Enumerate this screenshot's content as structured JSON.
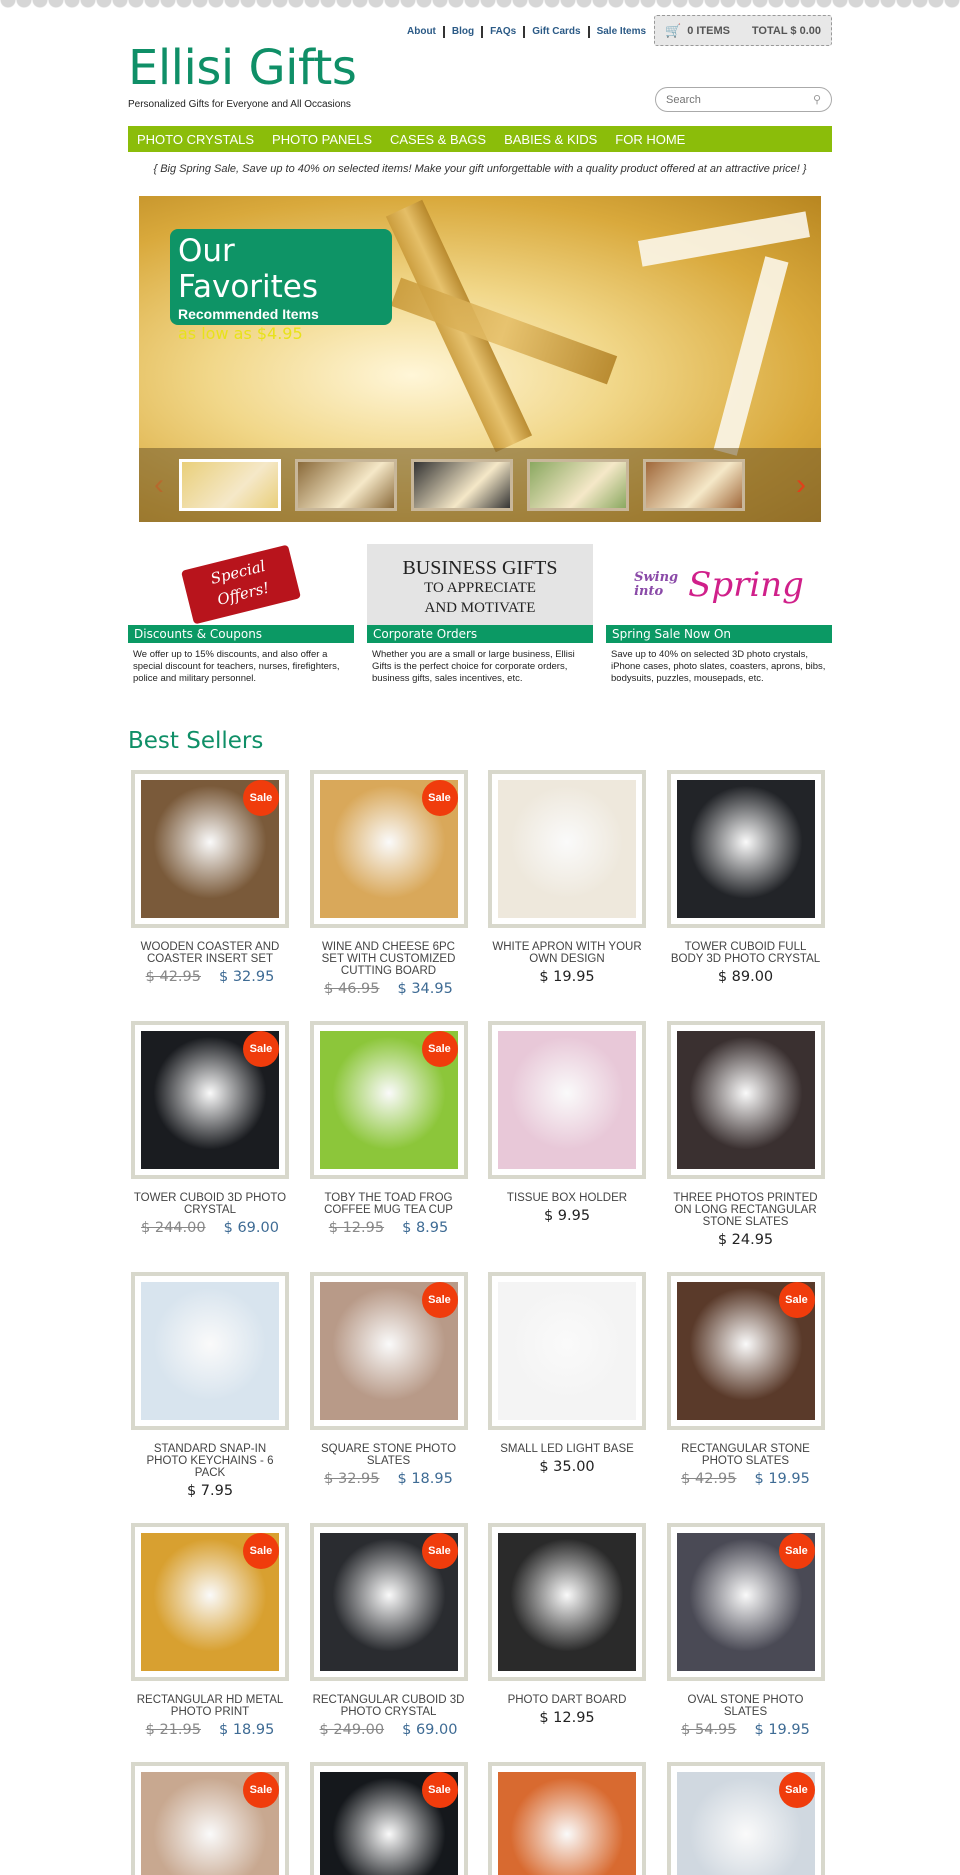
{
  "header": {
    "top_links": [
      "About",
      "Blog",
      "FAQs",
      "Gift Cards",
      "Sale Items"
    ],
    "cart": {
      "icon": "cart-icon",
      "items": "0 ITEMS",
      "total": "TOTAL $ 0.00"
    },
    "logo": "Ellisi Gifts",
    "tagline": "Personalized Gifts for Everyone and All Occasions",
    "search": {
      "placeholder": "Search",
      "icon": "search-icon"
    }
  },
  "nav": [
    "PHOTO CRYSTALS",
    "PHOTO PANELS",
    "CASES & BAGS",
    "BABIES & KIDS",
    "FOR HOME"
  ],
  "promo": "{ Big Spring Sale, Save up to 40% on selected items! Make your gift unforgettable with a quality product offered at an attractive price! }",
  "slider": {
    "title": "Our Favorites",
    "subtitle": "Recommended Items",
    "price_line": "as low as $4.95",
    "thumb_count": 5,
    "active_thumb": 1,
    "thumb_tones": [
      "#e9cf7a",
      "#8a6a3a",
      "#333333",
      "#8aa860",
      "#a0683a"
    ]
  },
  "features": [
    {
      "image_text": "Special Offers!",
      "title": "Discounts & Coupons",
      "text": "We offer up to 15% discounts, and also offer a special discount for teachers, nurses, firefighters, police and military personnel."
    },
    {
      "image_text_1": "BUSINESS GIFTS",
      "image_text_2": "TO APPRECIATE",
      "image_text_3": "AND MOTIVATE",
      "title": "Corporate Orders",
      "text": "Whether you are a small or large business, Ellisi Gifts is the perfect choice for corporate orders, business gifts, sales incentives, etc."
    },
    {
      "image_text_1": "Swing into",
      "image_text_2": "Spring",
      "title": "Spring Sale Now On",
      "text": "Save up to 40% on selected 3D photo crystals, iPhone cases, photo slates, coasters, aprons, bibs, bodysuits, puzzles, mousepads, etc."
    }
  ],
  "best_sellers": {
    "title": "Best Sellers",
    "sale_label": "Sale",
    "products": [
      {
        "name": "WOODEN COASTER AND COASTER INSERT SET",
        "old": "$ 42.95",
        "price": "$ 32.95",
        "sale": true,
        "tone": "#7a5a3a"
      },
      {
        "name": "WINE AND CHEESE 6PC SET WITH CUSTOMIZED CUTTING BOARD",
        "old": "$ 46.95",
        "price": "$ 34.95",
        "sale": true,
        "tone": "#d9a85a"
      },
      {
        "name": "WHITE APRON WITH YOUR OWN DESIGN",
        "price": "$ 19.95",
        "sale": false,
        "tone": "#eee8dc"
      },
      {
        "name": "TOWER CUBOID FULL BODY 3D PHOTO CRYSTAL",
        "price": "$ 89.00",
        "sale": false,
        "tone": "#222428"
      },
      {
        "name": "TOWER CUBOID 3D PHOTO CRYSTAL",
        "old": "$ 244.00",
        "price": "$ 69.00",
        "sale": true,
        "tone": "#1a1c20"
      },
      {
        "name": "TOBY THE TOAD FROG COFFEE MUG TEA CUP",
        "old": "$ 12.95",
        "price": "$ 8.95",
        "sale": true,
        "tone": "#8cc63a"
      },
      {
        "name": "TISSUE BOX HOLDER",
        "price": "$ 9.95",
        "sale": false,
        "tone": "#e8c8d8"
      },
      {
        "name": "THREE PHOTOS PRINTED ON LONG RECTANGULAR STONE SLATES",
        "price": "$ 24.95",
        "sale": false,
        "tone": "#3a3030"
      },
      {
        "name": "STANDARD SNAP-IN PHOTO KEYCHAINS - 6 PACK",
        "price": "$ 7.95",
        "sale": false,
        "tone": "#d8e4ee"
      },
      {
        "name": "SQUARE STONE PHOTO SLATES",
        "old": "$ 32.95",
        "price": "$ 18.95",
        "sale": true,
        "tone": "#b89a88"
      },
      {
        "name": "SMALL LED LIGHT BASE",
        "price": "$ 35.00",
        "sale": false,
        "tone": "#f4f4f4"
      },
      {
        "name": "RECTANGULAR STONE PHOTO SLATES",
        "old": "$ 42.95",
        "price": "$ 19.95",
        "sale": true,
        "tone": "#5a3a2a"
      },
      {
        "name": "RECTANGULAR HD METAL PHOTO PRINT",
        "old": "$ 21.95",
        "price": "$ 18.95",
        "sale": true,
        "tone": "#d8a030"
      },
      {
        "name": "RECTANGULAR CUBOID 3D PHOTO CRYSTAL",
        "old": "$ 249.00",
        "price": "$ 69.00",
        "sale": true,
        "tone": "#2a2c30"
      },
      {
        "name": "PHOTO DART BOARD",
        "price": "$ 12.95",
        "sale": false,
        "tone": "#2a2a2a"
      },
      {
        "name": "OVAL STONE PHOTO SLATES",
        "old": "$ 54.95",
        "price": "$ 19.95",
        "sale": true,
        "tone": "#4a4a55"
      },
      {
        "name": "",
        "sale": true,
        "tone": "#c8a890"
      },
      {
        "name": "",
        "sale": true,
        "tone": "#15181c"
      },
      {
        "name": "",
        "sale": false,
        "tone": "#d86a30"
      },
      {
        "name": "",
        "sale": true,
        "tone": "#d0d8e0"
      }
    ]
  }
}
